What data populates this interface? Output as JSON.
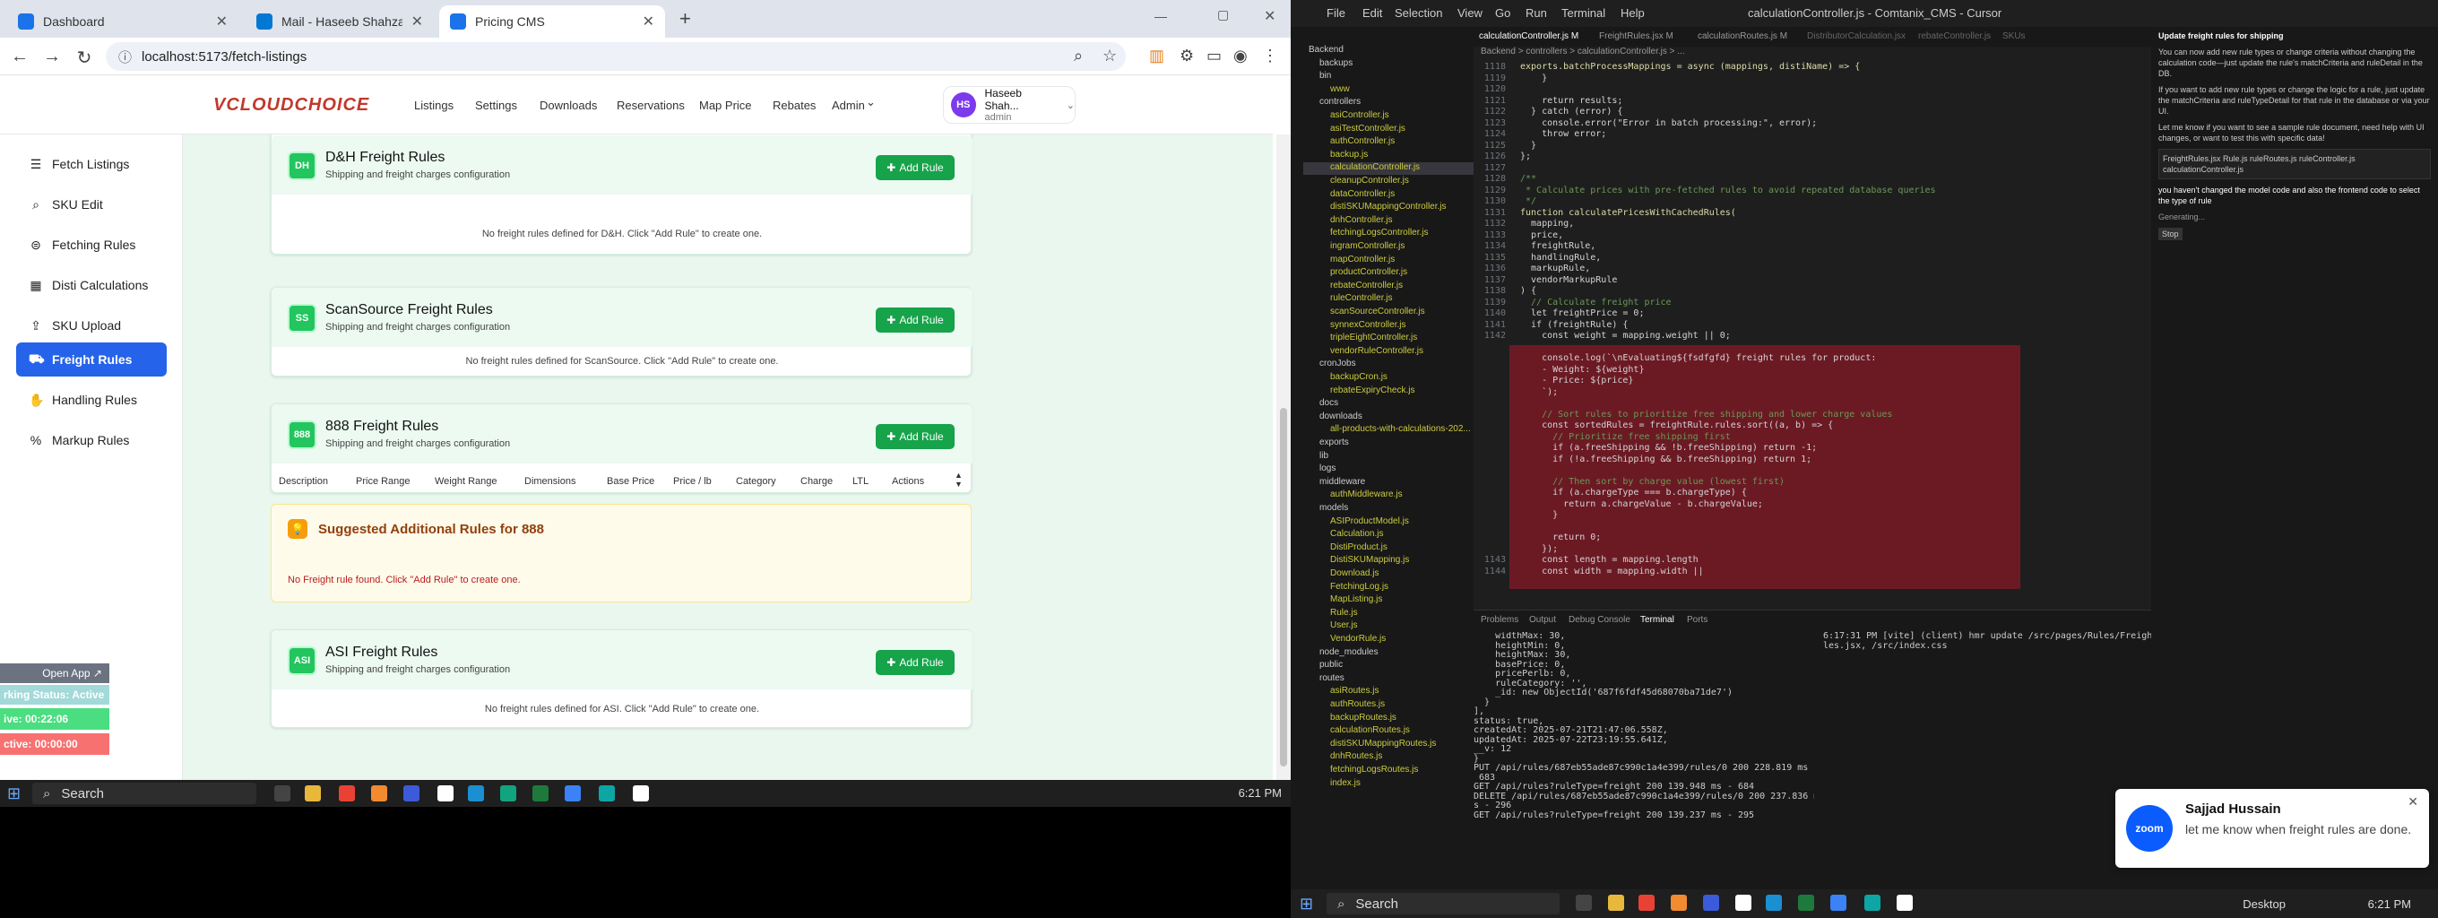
{
  "left": {
    "browser": {
      "tabs": [
        {
          "title": "Dashboard",
          "color": "#1a73e8"
        },
        {
          "title": "Mail - Haseeb Shahzad - Outlo",
          "color": "#0078d4"
        },
        {
          "title": "Pricing CMS",
          "color": "#1a73e8"
        }
      ],
      "new_tab": "+",
      "url": "localhost:5173/fetch-listings"
    },
    "app": {
      "logo": "VCLOUDCHOICE",
      "nav": [
        "Listings",
        "Settings",
        "Downloads",
        "Reservations",
        "Map Price",
        "Rebates",
        "Admin"
      ],
      "admin_caret": "⌄",
      "user": {
        "initials": "HS",
        "name": "Haseeb Shah...",
        "role": "admin"
      },
      "sidebar": [
        {
          "label": "Fetch Listings",
          "icon": "☰"
        },
        {
          "label": "SKU Edit",
          "icon": "⌕"
        },
        {
          "label": "Fetching Rules",
          "icon": "⊜"
        },
        {
          "label": "Disti Calculations",
          "icon": "▦"
        },
        {
          "label": "SKU Upload",
          "icon": "⇪"
        },
        {
          "label": "Freight Rules",
          "icon": "⛟"
        },
        {
          "label": "Handling Rules",
          "icon": "✋"
        },
        {
          "label": "Markup Rules",
          "icon": "%"
        }
      ],
      "active_sidebar": "Freight Rules",
      "cards": [
        {
          "code": "DH",
          "title": "D&H Freight Rules",
          "subtitle": "Shipping and freight charges configuration",
          "button": "Add Rule",
          "empty": "No freight rules defined for D&H. Click \"Add Rule\" to create one."
        },
        {
          "code": "SS",
          "title": "ScanSource Freight Rules",
          "subtitle": "Shipping and freight charges configuration",
          "button": "Add Rule",
          "empty": "No freight rules defined for ScanSource. Click \"Add Rule\" to create one."
        },
        {
          "code": "888",
          "title": "888 Freight Rules",
          "subtitle": "Shipping and freight charges configuration",
          "button": "Add Rule",
          "columns": [
            "Description",
            "Price Range",
            "Weight Range",
            "Dimensions",
            "Base Price",
            "Price / lb",
            "Category",
            "Charge",
            "LTL",
            "Actions"
          ]
        },
        {
          "code": "ASI",
          "title": "ASI Freight Rules",
          "subtitle": "Shipping and freight charges configuration",
          "button": "Add Rule",
          "empty": "No freight rules defined for ASI. Click \"Add Rule\" to create one."
        }
      ],
      "suggestion": {
        "title": "Suggested Additional Rules for 888",
        "message": "No Freight rule found. Click \"Add Rule\" to create one."
      }
    },
    "widget": {
      "open": "Open App ↗",
      "status": "rking Status: Active",
      "time1": "ive: 00:22:06",
      "time2": "ctive: 00:00:00"
    },
    "taskbar": {
      "search": "Search",
      "time": "6:21 PM"
    }
  },
  "right": {
    "title": "calculationController.js - Comtanix_CMS - Cursor",
    "menu": [
      "File",
      "Edit",
      "Selection",
      "View",
      "Go",
      "Run",
      "Terminal",
      "Help"
    ],
    "editor_tabs": [
      "calculationController.js M",
      "FreightRules.jsx M",
      "calculationRoutes.js M",
      "DistributorCalculation.jsx",
      "rebateController.js",
      "SKUs"
    ],
    "breadcrumb": "Backend > controllers > calculationController.js > ...",
    "explorer": [
      {
        "t": "Backend",
        "k": "folder",
        "d": 0
      },
      {
        "t": "backups",
        "k": "folder",
        "d": 1
      },
      {
        "t": "bin",
        "k": "folder",
        "d": 1
      },
      {
        "t": "www",
        "k": "file",
        "d": 2
      },
      {
        "t": "controllers",
        "k": "folder",
        "d": 1
      },
      {
        "t": "asiController.js",
        "k": "file",
        "d": 2
      },
      {
        "t": "asiTestController.js",
        "k": "file",
        "d": 2
      },
      {
        "t": "authController.js",
        "k": "file",
        "d": 2
      },
      {
        "t": "backup.js",
        "k": "file",
        "d": 2
      },
      {
        "t": "calculationController.js",
        "k": "file",
        "d": 2,
        "sel": true
      },
      {
        "t": "cleanupController.js",
        "k": "file",
        "d": 2
      },
      {
        "t": "dataController.js",
        "k": "file",
        "d": 2
      },
      {
        "t": "distiSKUMappingController.js",
        "k": "file",
        "d": 2
      },
      {
        "t": "dnhController.js",
        "k": "file",
        "d": 2
      },
      {
        "t": "fetchingLogsController.js",
        "k": "file",
        "d": 2
      },
      {
        "t": "ingramController.js",
        "k": "file",
        "d": 2
      },
      {
        "t": "mapController.js",
        "k": "file",
        "d": 2
      },
      {
        "t": "productController.js",
        "k": "file",
        "d": 2
      },
      {
        "t": "rebateController.js",
        "k": "file",
        "d": 2
      },
      {
        "t": "ruleController.js",
        "k": "file",
        "d": 2
      },
      {
        "t": "scanSourceController.js",
        "k": "file",
        "d": 2
      },
      {
        "t": "synnexController.js",
        "k": "file",
        "d": 2
      },
      {
        "t": "tripleEightController.js",
        "k": "file",
        "d": 2
      },
      {
        "t": "vendorRuleController.js",
        "k": "file",
        "d": 2
      },
      {
        "t": "cronJobs",
        "k": "folder",
        "d": 1
      },
      {
        "t": "backupCron.js",
        "k": "file",
        "d": 2
      },
      {
        "t": "rebateExpiryCheck.js",
        "k": "file",
        "d": 2
      },
      {
        "t": "docs",
        "k": "folder",
        "d": 1
      },
      {
        "t": "downloads",
        "k": "folder",
        "d": 1
      },
      {
        "t": "all-products-with-calculations-202...",
        "k": "file",
        "d": 2
      },
      {
        "t": "exports",
        "k": "folder",
        "d": 1
      },
      {
        "t": "lib",
        "k": "folder",
        "d": 1
      },
      {
        "t": "logs",
        "k": "folder",
        "d": 1
      },
      {
        "t": "middleware",
        "k": "folder",
        "d": 1
      },
      {
        "t": "authMiddleware.js",
        "k": "file",
        "d": 2
      },
      {
        "t": "models",
        "k": "folder",
        "d": 1
      },
      {
        "t": "ASIProductModel.js",
        "k": "file",
        "d": 2
      },
      {
        "t": "Calculation.js",
        "k": "file",
        "d": 2
      },
      {
        "t": "DistiProduct.js",
        "k": "file",
        "d": 2
      },
      {
        "t": "DistiSKUMapping.js",
        "k": "file",
        "d": 2
      },
      {
        "t": "Download.js",
        "k": "file",
        "d": 2
      },
      {
        "t": "FetchingLog.js",
        "k": "file",
        "d": 2
      },
      {
        "t": "MapListing.js",
        "k": "file",
        "d": 2
      },
      {
        "t": "Rule.js",
        "k": "file",
        "d": 2
      },
      {
        "t": "User.js",
        "k": "file",
        "d": 2
      },
      {
        "t": "VendorRule.js",
        "k": "file",
        "d": 2
      },
      {
        "t": "node_modules",
        "k": "folder",
        "d": 1
      },
      {
        "t": "public",
        "k": "folder",
        "d": 1
      },
      {
        "t": "routes",
        "k": "folder",
        "d": 1
      },
      {
        "t": "asiRoutes.js",
        "k": "file",
        "d": 2
      },
      {
        "t": "authRoutes.js",
        "k": "file",
        "d": 2
      },
      {
        "t": "backupRoutes.js",
        "k": "file",
        "d": 2
      },
      {
        "t": "calculationRoutes.js",
        "k": "file",
        "d": 2
      },
      {
        "t": "distiSKUMappingRoutes.js",
        "k": "file",
        "d": 2
      },
      {
        "t": "dnhRoutes.js",
        "k": "file",
        "d": 2
      },
      {
        "t": "fetchingLogsRoutes.js",
        "k": "file",
        "d": 2
      },
      {
        "t": "index.js",
        "k": "file",
        "d": 2
      }
    ],
    "code_lines": [
      {
        "n": "1118",
        "c": "exports.batchProcessMappings = async (mappings, distiName) => {"
      },
      {
        "n": "1119",
        "c": "    }"
      },
      {
        "n": "1120",
        "c": ""
      },
      {
        "n": "1121",
        "c": "    return results;"
      },
      {
        "n": "1122",
        "c": "  } catch (error) {"
      },
      {
        "n": "1123",
        "c": "    console.error(\"Error in batch processing:\", error);"
      },
      {
        "n": "1124",
        "c": "    throw error;"
      },
      {
        "n": "1125",
        "c": "  }"
      },
      {
        "n": "1126",
        "c": "};"
      },
      {
        "n": "1127",
        "c": ""
      },
      {
        "n": "1128",
        "c": "/**"
      },
      {
        "n": "1129",
        "c": " * Calculate prices with pre-fetched rules to avoid repeated database queries"
      },
      {
        "n": "1130",
        "c": " */"
      },
      {
        "n": "1131",
        "c": "function calculatePricesWithCachedRules("
      },
      {
        "n": "1132",
        "c": "  mapping,"
      },
      {
        "n": "1133",
        "c": "  price,"
      },
      {
        "n": "1134",
        "c": "  freightRule,"
      },
      {
        "n": "1135",
        "c": "  handlingRule,"
      },
      {
        "n": "1136",
        "c": "  markupRule,"
      },
      {
        "n": "1137",
        "c": "  vendorMarkupRule"
      },
      {
        "n": "1138",
        "c": ") {"
      },
      {
        "n": "1139",
        "c": "  // Calculate freight price"
      },
      {
        "n": "1140",
        "c": "  let freightPrice = 0;"
      },
      {
        "n": "1141",
        "c": "  if (freightRule) {"
      },
      {
        "n": "1142",
        "c": "    const weight = mapping.weight || 0;"
      },
      {
        "n": "",
        "c": ""
      },
      {
        "n": "",
        "c": "    console.log(`\\nEvaluating${fsdfgfd} freight rules for product:"
      },
      {
        "n": "",
        "c": "    - Weight: ${weight}"
      },
      {
        "n": "",
        "c": "    - Price: ${price}"
      },
      {
        "n": "",
        "c": "    `);"
      },
      {
        "n": "",
        "c": ""
      },
      {
        "n": "",
        "c": "    // Sort rules to prioritize free shipping and lower charge values"
      },
      {
        "n": "",
        "c": "    const sortedRules = freightRule.rules.sort((a, b) => {"
      },
      {
        "n": "",
        "c": "      // Prioritize free shipping first"
      },
      {
        "n": "",
        "c": "      if (a.freeShipping && !b.freeShipping) return -1;"
      },
      {
        "n": "",
        "c": "      if (!a.freeShipping && b.freeShipping) return 1;"
      },
      {
        "n": "",
        "c": ""
      },
      {
        "n": "",
        "c": "      // Then sort by charge value (lowest first)"
      },
      {
        "n": "",
        "c": "      if (a.chargeType === b.chargeType) {"
      },
      {
        "n": "",
        "c": "        return a.chargeValue - b.chargeValue;"
      },
      {
        "n": "",
        "c": "      }"
      },
      {
        "n": "",
        "c": ""
      },
      {
        "n": "",
        "c": "      return 0;"
      },
      {
        "n": "",
        "c": "    });"
      },
      {
        "n": "1143",
        "c": "    const length = mapping.length"
      },
      {
        "n": "1144",
        "c": "    const width = mapping.width ||"
      }
    ],
    "panel_tabs": [
      "Problems",
      "Output",
      "Debug Console",
      "Terminal",
      "Ports"
    ],
    "terminal": [
      "    widthMax: 30,",
      "    heightMin: 0,",
      "    heightMax: 30,",
      "    basePrice: 0,",
      "    pricePerlb: 0,",
      "    ruleCategory: '',",
      "    _id: new ObjectId('687f6fdf45d68070ba71de7')",
      "  }",
      "],",
      "status: true,",
      "createdAt: 2025-07-21T21:47:06.558Z,",
      "updatedAt: 2025-07-22T23:19:55.641Z,",
      "__v: 12",
      "}",
      "PUT /api/rules/687eb55ade87c990c1a4e399/rules/0 200 228.819 ms -",
      " 683",
      "GET /api/rules?ruleType=freight 200 139.948 ms - 684",
      "DELETE /api/rules/687eb55ade87c990c1a4e399/rules/0 200 237.836 m",
      "s - 296",
      "GET /api/rules?ruleType=freight 200 139.237 ms - 295"
    ],
    "terminal2": [
      "6:17:31 PM [vite] (client) hmr update /src/pages/Rules/FreightRu",
      "les.jsx, /src/index.css"
    ],
    "chat": {
      "title": "Update freight rules for shipping",
      "p1": "You can now add new rule types or change criteria without changing the calculation code—just update the rule's matchCriteria and ruleDetail in the DB.",
      "p2": "If you want to add new rule types or change the logic for a rule, just update the matchCriteria and ruleTypeDetail for that rule in the database or via your UI.",
      "p3": "Let me know if you want to see a sample rule document, need help with UI changes, or want to test this with specific data!",
      "files": "FreightRules.jsx  Rule.js  ruleRoutes.js  ruleController.js  calculationController.js",
      "user_msg": "you haven't changed the model code and also the frontend code to select the type of rule",
      "status": "Generating...",
      "stop": "Stop"
    },
    "zoom": {
      "logo": "zoom",
      "name": "Sajjad Hussain",
      "message": "let me know when freight rules are done."
    },
    "taskbar": {
      "search": "Search",
      "desktop": "Desktop",
      "time": "6:21 PM"
    }
  }
}
